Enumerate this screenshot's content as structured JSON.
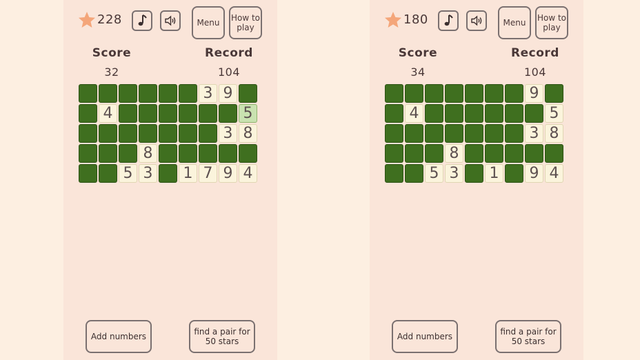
{
  "colors": {
    "background": "#fdefe1",
    "panel": "#fae5d9",
    "filled_cell": "#3f6f1f",
    "number_cell": "#fbf4dc",
    "selected_cell": "#c9e2b0",
    "star": "#f4a67a",
    "text": "#4a3838"
  },
  "icons": {
    "star": "star-icon",
    "music": "music-note-icon",
    "sound": "speaker-icon"
  },
  "panels": [
    {
      "stars": "228",
      "menu_label": "Menu",
      "howto_label": "How to play",
      "score_label": "Score",
      "score_value": "32",
      "record_label": "Record",
      "record_value": "104",
      "add_numbers_label": "Add numbers",
      "find_pair_label": "find a pair for 50 stars",
      "grid": [
        [
          "#",
          "#",
          "#",
          "#",
          "#",
          "#",
          "3",
          "9",
          "#"
        ],
        [
          "#",
          "4",
          "#",
          "#",
          "#",
          "#",
          "#",
          "#",
          "5*"
        ],
        [
          "#",
          "#",
          "#",
          "#",
          "#",
          "#",
          "#",
          "3",
          "8"
        ],
        [
          "#",
          "#",
          "#",
          "8",
          "#",
          "#",
          "#",
          "#",
          "#"
        ],
        [
          "#",
          "#",
          "5",
          "3",
          "#",
          "1",
          "7",
          "9",
          "4"
        ]
      ]
    },
    {
      "stars": "180",
      "menu_label": "Menu",
      "howto_label": "How to play",
      "score_label": "Score",
      "score_value": "34",
      "record_label": "Record",
      "record_value": "104",
      "add_numbers_label": "Add numbers",
      "find_pair_label": "find a pair for 50 stars",
      "grid": [
        [
          "#",
          "#",
          "#",
          "#",
          "#",
          "#",
          "#",
          "9",
          "#"
        ],
        [
          "#",
          "4",
          "#",
          "#",
          "#",
          "#",
          "#",
          "#",
          "5"
        ],
        [
          "#",
          "#",
          "#",
          "#",
          "#",
          "#",
          "#",
          "3",
          "8"
        ],
        [
          "#",
          "#",
          "#",
          "8",
          "#",
          "#",
          "#",
          "#",
          "#"
        ],
        [
          "#",
          "#",
          "5",
          "3",
          "#",
          "1",
          "#",
          "9",
          "4"
        ]
      ]
    }
  ]
}
